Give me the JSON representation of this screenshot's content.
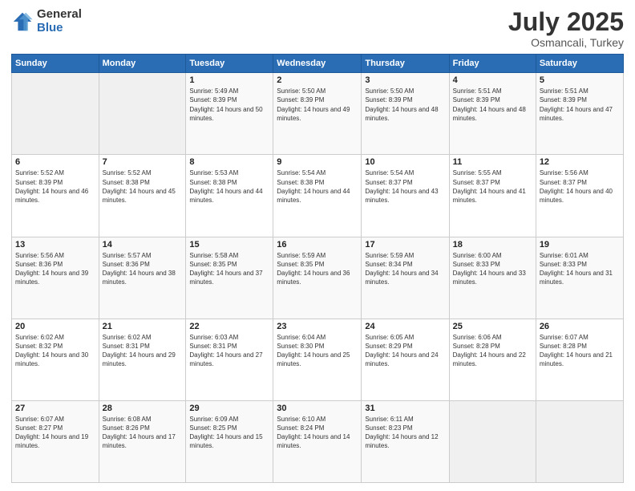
{
  "logo": {
    "general": "General",
    "blue": "Blue"
  },
  "title": "July 2025",
  "subtitle": "Osmancali, Turkey",
  "days_header": [
    "Sunday",
    "Monday",
    "Tuesday",
    "Wednesday",
    "Thursday",
    "Friday",
    "Saturday"
  ],
  "weeks": [
    [
      {
        "day": "",
        "info": ""
      },
      {
        "day": "",
        "info": ""
      },
      {
        "day": "1",
        "info": "Sunrise: 5:49 AM\nSunset: 8:39 PM\nDaylight: 14 hours and 50 minutes."
      },
      {
        "day": "2",
        "info": "Sunrise: 5:50 AM\nSunset: 8:39 PM\nDaylight: 14 hours and 49 minutes."
      },
      {
        "day": "3",
        "info": "Sunrise: 5:50 AM\nSunset: 8:39 PM\nDaylight: 14 hours and 48 minutes."
      },
      {
        "day": "4",
        "info": "Sunrise: 5:51 AM\nSunset: 8:39 PM\nDaylight: 14 hours and 48 minutes."
      },
      {
        "day": "5",
        "info": "Sunrise: 5:51 AM\nSunset: 8:39 PM\nDaylight: 14 hours and 47 minutes."
      }
    ],
    [
      {
        "day": "6",
        "info": "Sunrise: 5:52 AM\nSunset: 8:39 PM\nDaylight: 14 hours and 46 minutes."
      },
      {
        "day": "7",
        "info": "Sunrise: 5:52 AM\nSunset: 8:38 PM\nDaylight: 14 hours and 45 minutes."
      },
      {
        "day": "8",
        "info": "Sunrise: 5:53 AM\nSunset: 8:38 PM\nDaylight: 14 hours and 44 minutes."
      },
      {
        "day": "9",
        "info": "Sunrise: 5:54 AM\nSunset: 8:38 PM\nDaylight: 14 hours and 44 minutes."
      },
      {
        "day": "10",
        "info": "Sunrise: 5:54 AM\nSunset: 8:37 PM\nDaylight: 14 hours and 43 minutes."
      },
      {
        "day": "11",
        "info": "Sunrise: 5:55 AM\nSunset: 8:37 PM\nDaylight: 14 hours and 41 minutes."
      },
      {
        "day": "12",
        "info": "Sunrise: 5:56 AM\nSunset: 8:37 PM\nDaylight: 14 hours and 40 minutes."
      }
    ],
    [
      {
        "day": "13",
        "info": "Sunrise: 5:56 AM\nSunset: 8:36 PM\nDaylight: 14 hours and 39 minutes."
      },
      {
        "day": "14",
        "info": "Sunrise: 5:57 AM\nSunset: 8:36 PM\nDaylight: 14 hours and 38 minutes."
      },
      {
        "day": "15",
        "info": "Sunrise: 5:58 AM\nSunset: 8:35 PM\nDaylight: 14 hours and 37 minutes."
      },
      {
        "day": "16",
        "info": "Sunrise: 5:59 AM\nSunset: 8:35 PM\nDaylight: 14 hours and 36 minutes."
      },
      {
        "day": "17",
        "info": "Sunrise: 5:59 AM\nSunset: 8:34 PM\nDaylight: 14 hours and 34 minutes."
      },
      {
        "day": "18",
        "info": "Sunrise: 6:00 AM\nSunset: 8:33 PM\nDaylight: 14 hours and 33 minutes."
      },
      {
        "day": "19",
        "info": "Sunrise: 6:01 AM\nSunset: 8:33 PM\nDaylight: 14 hours and 31 minutes."
      }
    ],
    [
      {
        "day": "20",
        "info": "Sunrise: 6:02 AM\nSunset: 8:32 PM\nDaylight: 14 hours and 30 minutes."
      },
      {
        "day": "21",
        "info": "Sunrise: 6:02 AM\nSunset: 8:31 PM\nDaylight: 14 hours and 29 minutes."
      },
      {
        "day": "22",
        "info": "Sunrise: 6:03 AM\nSunset: 8:31 PM\nDaylight: 14 hours and 27 minutes."
      },
      {
        "day": "23",
        "info": "Sunrise: 6:04 AM\nSunset: 8:30 PM\nDaylight: 14 hours and 25 minutes."
      },
      {
        "day": "24",
        "info": "Sunrise: 6:05 AM\nSunset: 8:29 PM\nDaylight: 14 hours and 24 minutes."
      },
      {
        "day": "25",
        "info": "Sunrise: 6:06 AM\nSunset: 8:28 PM\nDaylight: 14 hours and 22 minutes."
      },
      {
        "day": "26",
        "info": "Sunrise: 6:07 AM\nSunset: 8:28 PM\nDaylight: 14 hours and 21 minutes."
      }
    ],
    [
      {
        "day": "27",
        "info": "Sunrise: 6:07 AM\nSunset: 8:27 PM\nDaylight: 14 hours and 19 minutes."
      },
      {
        "day": "28",
        "info": "Sunrise: 6:08 AM\nSunset: 8:26 PM\nDaylight: 14 hours and 17 minutes."
      },
      {
        "day": "29",
        "info": "Sunrise: 6:09 AM\nSunset: 8:25 PM\nDaylight: 14 hours and 15 minutes."
      },
      {
        "day": "30",
        "info": "Sunrise: 6:10 AM\nSunset: 8:24 PM\nDaylight: 14 hours and 14 minutes."
      },
      {
        "day": "31",
        "info": "Sunrise: 6:11 AM\nSunset: 8:23 PM\nDaylight: 14 hours and 12 minutes."
      },
      {
        "day": "",
        "info": ""
      },
      {
        "day": "",
        "info": ""
      }
    ]
  ]
}
